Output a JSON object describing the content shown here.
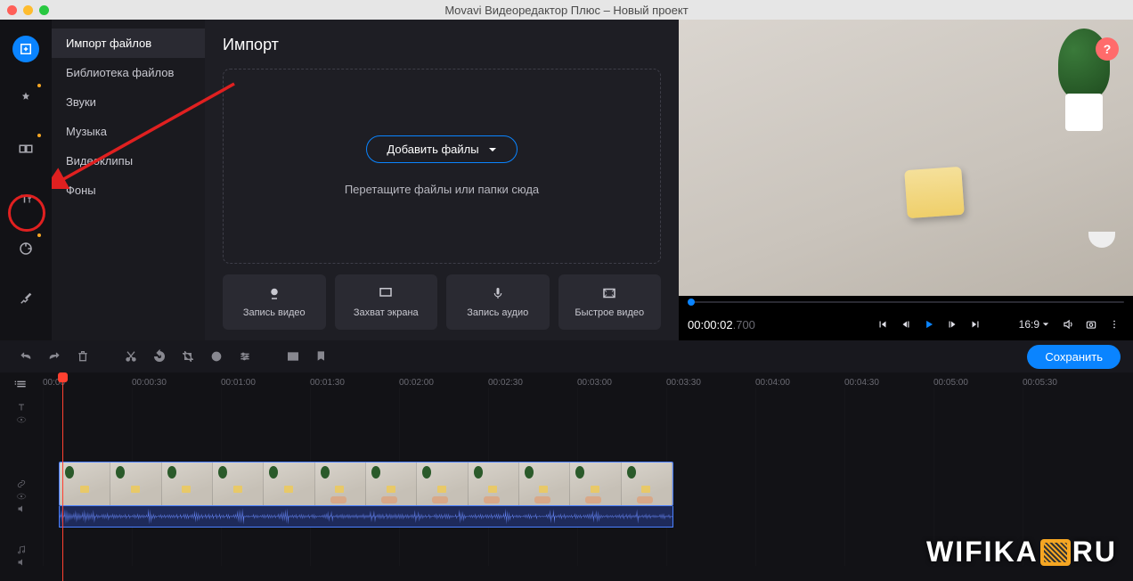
{
  "titlebar": {
    "title": "Movavi Видеоредактор Плюс – Новый проект"
  },
  "leftToolbar": {
    "importTip": "import",
    "filtersTip": "filters",
    "transitionsTip": "transitions",
    "titlesTip": "titles",
    "stickersTip": "stickers",
    "moreTip": "more"
  },
  "sideMenu": {
    "items": [
      "Импорт файлов",
      "Библиотека файлов",
      "Звуки",
      "Музыка",
      "Видеоклипы",
      "Фоны"
    ]
  },
  "importPanel": {
    "heading": "Импорт",
    "addFiles": "Добавить файлы",
    "dropHint": "Перетащите файлы или папки сюда",
    "cards": [
      "Запись видео",
      "Захват экрана",
      "Запись аудио",
      "Быстрое видео"
    ]
  },
  "preview": {
    "help": "?",
    "time": "00:00:02",
    "timeMs": ".700",
    "ratio": "16:9"
  },
  "editToolbar": {
    "saveLabel": "Сохранить"
  },
  "timeline": {
    "ticks": [
      "00:00",
      "00:00:30",
      "00:01:00",
      "00:01:30",
      "00:02:00",
      "00:02:30",
      "00:03:00",
      "00:03:30",
      "00:04:00",
      "00:04:30",
      "00:05:00",
      "00:05:30"
    ]
  },
  "watermark": {
    "l": "WIFIKA",
    "r": "RU"
  }
}
